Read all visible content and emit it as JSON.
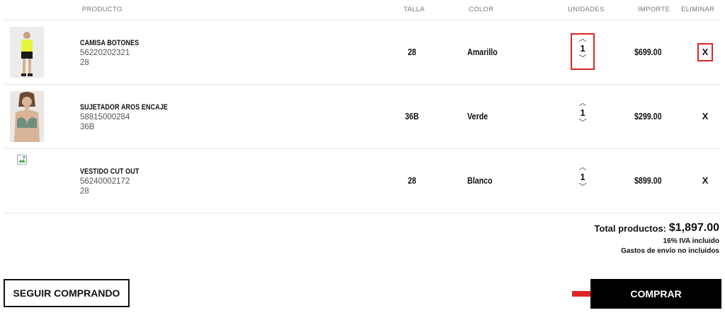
{
  "header": {
    "producto": "PRODUCTO",
    "talla": "TALLA",
    "color": "COLOR",
    "unidades": "UNIDADES",
    "importe": "IMPORTE",
    "eliminar": "ELIMINAR"
  },
  "items": [
    {
      "name": "CAMISA BOTONES",
      "code": "56220202321",
      "size_sub": "28",
      "talla": "28",
      "color": "Amarillo",
      "qty": "1",
      "importe": "$699.00",
      "delete": "X"
    },
    {
      "name": "SUJETADOR AROS ENCAJE",
      "code": "58815000284",
      "size_sub": "36B",
      "talla": "36B",
      "color": "Verde",
      "qty": "1",
      "importe": "$299.00",
      "delete": "X"
    },
    {
      "name": "VESTIDO CUT OUT",
      "code": "56240002172",
      "size_sub": "28",
      "talla": "28",
      "color": "Blanco",
      "qty": "1",
      "importe": "$899.00",
      "delete": "X"
    }
  ],
  "totals": {
    "label": "Total productos:",
    "value": "$1,897.00",
    "iva_note": "16% IVA incluido",
    "shipping_note": "Gastos de envío no incluidos"
  },
  "actions": {
    "continue_label": "SEGUIR COMPRANDO",
    "buy_label": "COMPRAR"
  },
  "colors": {
    "highlight": "#e02424",
    "buy_bg": "#000000"
  }
}
